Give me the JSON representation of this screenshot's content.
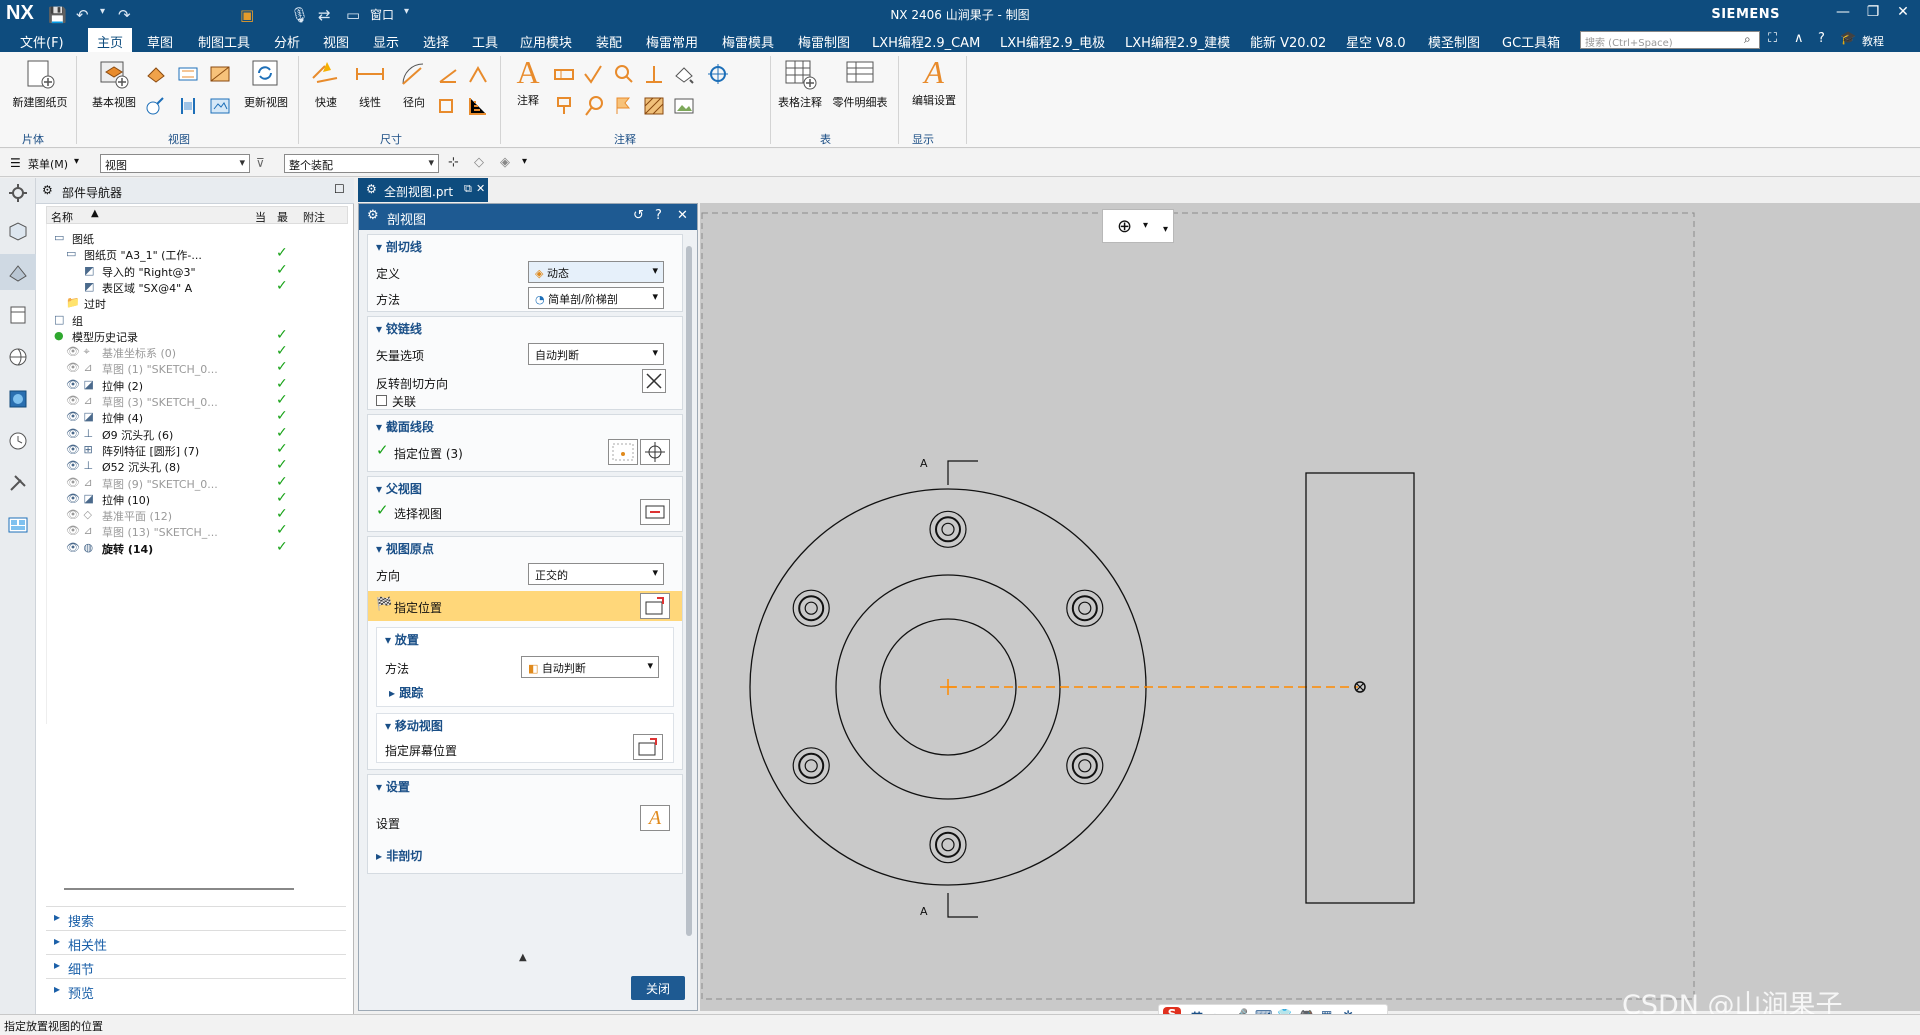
{
  "titlebar": {
    "logo": "NX",
    "title": "NX 2406 山涧果子 - 制图",
    "window_menu": "窗口",
    "brand": "SIEMENS"
  },
  "menubar": {
    "file": "文件(F)",
    "tabs": [
      "主页",
      "草图",
      "制图工具",
      "分析",
      "视图",
      "显示",
      "选择",
      "工具",
      "应用模块",
      "装配",
      "梅雷常用",
      "梅雷模具",
      "梅雷制图",
      "LXH编程2.9_CAM",
      "LXH编程2.9_电极",
      "LXH编程2.9_建模",
      "能新 V20.02",
      "星空 V8.0",
      "模圣制图",
      "GC工具箱"
    ],
    "active_tab": "主页",
    "search_placeholder": "搜索 (Ctrl+Space)",
    "help": "教程"
  },
  "ribbon": {
    "buttons": {
      "new_sheet": "新建图纸页",
      "base_view": "基本视图",
      "update_view": "更新视图",
      "quick": "快速",
      "linear": "线性",
      "radial": "径向",
      "note": "注释",
      "table_note": "表格注释",
      "parts_list": "零件明细表",
      "edit_settings": "编辑设置"
    },
    "groups": {
      "sheet": "片体",
      "view": "视图",
      "dimension": "尺寸",
      "annotation": "注释",
      "table": "表",
      "display": "显示"
    }
  },
  "toolbar2": {
    "menu": "菜单(M)",
    "filter_value": "视图",
    "assembly_value": "整个装配"
  },
  "navigator": {
    "title": "部件导航器",
    "columns": {
      "name": "名称",
      "current": "当",
      "latest": "最",
      "note": "附注"
    },
    "rows": [
      {
        "label": "图纸",
        "gray": false,
        "check": false
      },
      {
        "label": "图纸页 \"A3_1\" (工作-...",
        "gray": false,
        "check": true
      },
      {
        "label": "导入的 \"Right@3\"",
        "gray": false,
        "check": true
      },
      {
        "label": "表区域 \"SX@4\" A",
        "gray": false,
        "check": true
      },
      {
        "label": "过时",
        "gray": false,
        "check": false
      },
      {
        "label": "组",
        "gray": false,
        "check": false
      },
      {
        "label": "模型历史记录",
        "gray": false,
        "check": true
      },
      {
        "label": "基准坐标系 (0)",
        "gray": true,
        "check": true
      },
      {
        "label": "草图 (1) \"SKETCH_0...",
        "gray": true,
        "check": true
      },
      {
        "label": "拉伸 (2)",
        "gray": false,
        "check": true
      },
      {
        "label": "草图 (3) \"SKETCH_0...",
        "gray": true,
        "check": true
      },
      {
        "label": "拉伸 (4)",
        "gray": false,
        "check": true
      },
      {
        "label": "Ø9 沉头孔 (6)",
        "gray": false,
        "check": true
      },
      {
        "label": "阵列特征 [圆形] (7)",
        "gray": false,
        "check": true
      },
      {
        "label": "Ø52 沉头孔 (8)",
        "gray": false,
        "check": true
      },
      {
        "label": "草图 (9) \"SKETCH_0...",
        "gray": true,
        "check": true
      },
      {
        "label": "拉伸 (10)",
        "gray": false,
        "check": true
      },
      {
        "label": "基准平面 (12)",
        "gray": true,
        "check": true
      },
      {
        "label": "草图 (13) \"SKETCH_...",
        "gray": true,
        "check": true
      },
      {
        "label": "旋转 (14)",
        "gray": false,
        "check": true
      }
    ],
    "accordion": [
      "搜索",
      "相关性",
      "细节",
      "预览"
    ]
  },
  "dialog": {
    "tab_title": "全剖视图.prt",
    "title": "剖视图",
    "sections": {
      "cut_line": "剖切线",
      "hinge_line": "铰链线",
      "section_segment": "截面线段",
      "parent_view": "父视图",
      "view_origin": "视图原点",
      "placement": "放置",
      "tracking": "跟踪",
      "move_view": "移动视图",
      "settings": "设置",
      "non_section": "非剖切"
    },
    "fields": {
      "definition_label": "定义",
      "definition_value": "动态",
      "method_label": "方法",
      "method_value": "简单剖/阶梯剖",
      "vector_label": "矢量选项",
      "vector_value": "自动判断",
      "reverse_label": "反转剖切方向",
      "associative_label": "关联",
      "specify_location": "指定位置 (3)",
      "select_view": "选择视图",
      "orientation_label": "方向",
      "orientation_value": "正交的",
      "specify_position": "指定位置",
      "placement_method_label": "方法",
      "placement_method_value": "自动判断",
      "screen_position": "指定屏幕位置",
      "settings_label": "设置"
    },
    "close": "关闭"
  },
  "drawing": {
    "label_top": "A",
    "label_bottom": "A"
  },
  "status": "指定放置视图的位置",
  "watermark": "CSDN @山涧果子",
  "ime": {
    "lang": "英"
  },
  "colors": {
    "nx_blue": "#0e4c7e",
    "check_green": "#19a319",
    "highlight": "#ffd77a",
    "section_line": "#ff8a00"
  }
}
